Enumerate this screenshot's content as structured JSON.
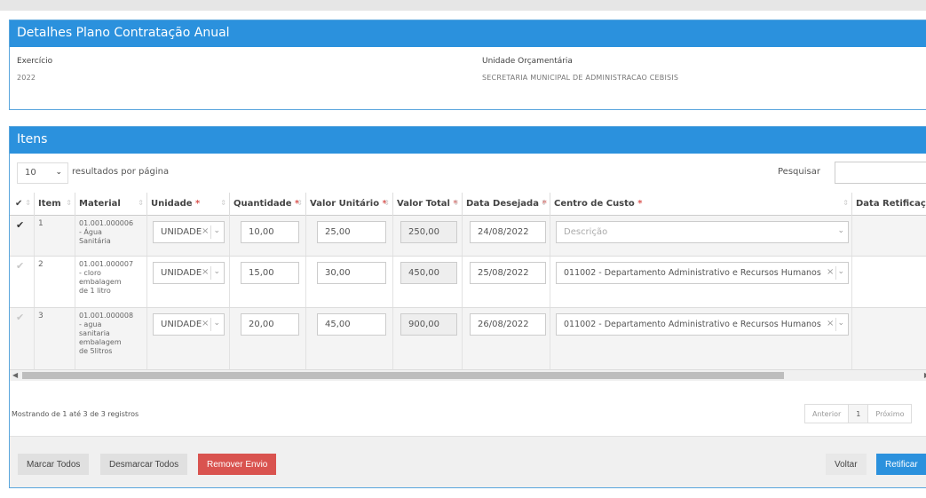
{
  "details": {
    "title": "Detalhes Plano Contratação Anual",
    "exercicio_label": "Exercício",
    "exercicio_value": "2022",
    "unidade_label": "Unidade Orçamentária",
    "unidade_value": "SECRETARIA MUNICIPAL DE ADMINISTRACAO CEBISIS"
  },
  "items": {
    "title": "Itens",
    "page_length": "10",
    "page_length_text": "resultados por página",
    "search_label": "Pesquisar",
    "columns": {
      "check": "✔",
      "item": "Item",
      "material": "Material",
      "unidade": "Unidade",
      "quantidade": "Quantidade",
      "valor_unitario": "Valor Unitário",
      "valor_total": "Valor Total",
      "data_desejada": "Data Desejada",
      "centro_custo": "Centro de Custo",
      "data_retificacao": "Data Retificação"
    },
    "required_mark": "*",
    "rows": [
      {
        "item": "1",
        "material_lines": [
          "01.001.000006",
          "- Água",
          "Sanitária"
        ],
        "unidade": "UNIDADE",
        "quantidade": "10,00",
        "valor_unitario": "25,00",
        "valor_total": "250,00",
        "data_desejada": "24/08/2022",
        "centro_custo": "",
        "centro_custo_placeholder": "Descrição"
      },
      {
        "item": "2",
        "material_lines": [
          "01.001.000007",
          "- cloro",
          "embalagem",
          "de 1 litro"
        ],
        "unidade": "UNIDADE",
        "quantidade": "15,00",
        "valor_unitario": "30,00",
        "valor_total": "450,00",
        "data_desejada": "25/08/2022",
        "centro_custo": "011002 - Departamento Administrativo e Recursos Humanos",
        "centro_custo_placeholder": ""
      },
      {
        "item": "3",
        "material_lines": [
          "01.001.000008",
          "- agua",
          "sanitaria",
          "embalagem",
          "de 5litros"
        ],
        "unidade": "UNIDADE",
        "quantidade": "20,00",
        "valor_unitario": "45,00",
        "valor_total": "900,00",
        "data_desejada": "26/08/2022",
        "centro_custo": "011002 - Departamento Administrativo e Recursos Humanos",
        "centro_custo_placeholder": ""
      }
    ],
    "info": "Mostrando de 1 até 3 de 3 registros",
    "pagination": {
      "previous": "Anterior",
      "current": "1",
      "next": "Próximo"
    }
  },
  "footer": {
    "mark_all": "Marcar Todos",
    "unmark_all": "Desmarcar Todos",
    "remove_send": "Remover Envio",
    "back": "Voltar",
    "rectify": "Retificar"
  },
  "colors": {
    "header_blue": "#2b91dd",
    "danger_red": "#d9534f",
    "required_red": "#d9534f"
  },
  "icons": {
    "check": "✔",
    "clear": "×",
    "dropdown": "⌄",
    "sort": "⇕",
    "scroll_left": "◀",
    "scroll_right": "▶"
  }
}
